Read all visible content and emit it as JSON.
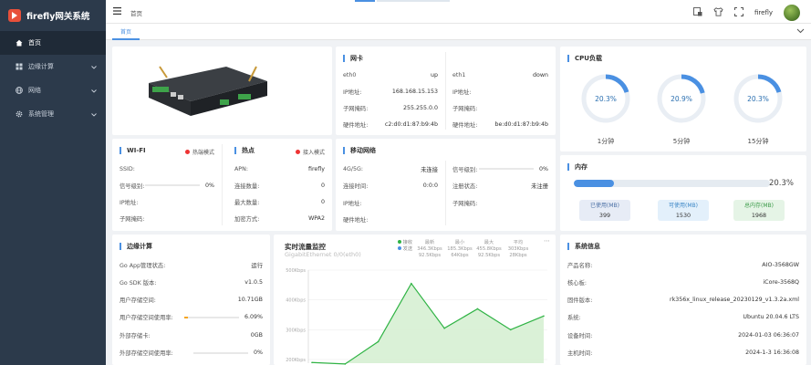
{
  "app": {
    "title": "firefly网关系统"
  },
  "sidebar": {
    "items": [
      {
        "label": "首页",
        "icon": "home-icon",
        "active": true,
        "has_arrow": false
      },
      {
        "label": "边缘计算",
        "icon": "grid-icon",
        "active": false,
        "has_arrow": true
      },
      {
        "label": "网络",
        "icon": "globe-icon",
        "active": false,
        "has_arrow": true
      },
      {
        "label": "系统管理",
        "icon": "gear-icon",
        "active": false,
        "has_arrow": true
      }
    ]
  },
  "header": {
    "breadcrumb": "首页",
    "username": "firefly"
  },
  "tabs": [
    {
      "label": "首页"
    }
  ],
  "nic": {
    "title": "网卡",
    "eth0": {
      "name": "eth0",
      "status": "up",
      "ip_label": "IP地址:",
      "ip": "168.168.15.153",
      "mask_label": "子网掩码:",
      "mask": "255.255.0.0",
      "mac_label": "硬件地址:",
      "mac": "c2:d0:d1:87:b9:4b"
    },
    "eth1": {
      "name": "eth1",
      "status": "down",
      "ip_label": "IP地址:",
      "ip": "",
      "mask_label": "子网掩码:",
      "mask": "",
      "mac_label": "硬件地址:",
      "mac": "be:d0:d1:87:b9:4b"
    }
  },
  "cpu": {
    "title": "CPU负载",
    "gauges": [
      {
        "value": "20.3%",
        "fraction": 0.203,
        "label": "1分钟"
      },
      {
        "value": "20.9%",
        "fraction": 0.209,
        "label": "5分钟"
      },
      {
        "value": "20.3%",
        "fraction": 0.203,
        "label": "15分钟"
      }
    ],
    "color": "#4a90e2"
  },
  "wifi": {
    "title": "WI-FI",
    "mode": "热端模式",
    "ssid_label": "SSID:",
    "ssid": "",
    "signal_label": "信号级别:",
    "signal": "0%",
    "ip_label": "IP地址:",
    "ip": "",
    "mask_label": "子网掩码:",
    "mask": ""
  },
  "hotspot": {
    "title": "热点",
    "mode": "接入模式",
    "apn_label": "APN:",
    "apn": "firefly",
    "conn_label": "连接数量:",
    "conn": "0",
    "max_label": "最大数量:",
    "max": "0",
    "enc_label": "加密方式:",
    "enc": "WPA2"
  },
  "mobile": {
    "title": "移动网络",
    "rows_left": [
      {
        "label": "4G/5G:",
        "value": "未连接"
      },
      {
        "label": "连接时间:",
        "value": "0:0:0"
      },
      {
        "label": "IP地址:",
        "value": ""
      },
      {
        "label": "硬件地址:",
        "value": ""
      }
    ],
    "rows_right": [
      {
        "label": "信号级别:",
        "value": "0%",
        "bar": 0
      },
      {
        "label": "注册状态:",
        "value": "未注册"
      },
      {
        "label": "子网掩码:",
        "value": ""
      }
    ]
  },
  "memory": {
    "title": "内存",
    "percent": "20.3%",
    "fraction": 0.203,
    "used_label": "已使用(MB)",
    "used": "399",
    "avail_label": "可使用(MB)",
    "avail": "1530",
    "total_label": "总内存(MB)",
    "total": "1968"
  },
  "edge": {
    "title": "边缘计算",
    "rows": [
      {
        "label": "Go App管理状态:",
        "value": "运行"
      },
      {
        "label": "Go SDK 版本:",
        "value": "v1.0.5"
      },
      {
        "label": "用户存储空间:",
        "value": "10.71GB"
      },
      {
        "label": "用户存储空间使用率:",
        "value": "6.09%",
        "bar": 0.0609
      },
      {
        "label": "外部存储卡:",
        "value": "0GB"
      },
      {
        "label": "外部存储空间使用率:",
        "value": "0%",
        "bar": 0
      }
    ]
  },
  "traffic": {
    "title": "实时流量监控",
    "subtitle": "GigabitEthernet 0/0(eth0)",
    "legend": [
      {
        "name": "接收",
        "color": "#2fb344"
      },
      {
        "name": "发送",
        "color": "#4a90e2"
      }
    ],
    "columns": [
      {
        "head": "最新",
        "recv": "346.3Kbps",
        "send": "92.5Kbps"
      },
      {
        "head": "最小",
        "recv": "185.3Kbps",
        "send": "64Kbps"
      },
      {
        "head": "最大",
        "recv": "455.8Kbps",
        "send": "92.5Kbps"
      },
      {
        "head": "平均",
        "recv": "303Kbps",
        "send": "28Kbps"
      }
    ]
  },
  "chart_data": {
    "type": "area",
    "title": "实时流量监控",
    "yticks": [
      "500Kbps",
      "400Kbps",
      "300Kbps",
      "200Kbps"
    ],
    "ylim": [
      200,
      500
    ],
    "series": [
      {
        "name": "接收",
        "values": [
          190,
          185,
          260,
          455,
          305,
          370,
          300,
          346
        ]
      }
    ]
  },
  "sysinfo": {
    "title": "系统信息",
    "rows": [
      {
        "label": "产品名称:",
        "value": "AIO-3568GW"
      },
      {
        "label": "核心板:",
        "value": "iCore-3568Q"
      },
      {
        "label": "固件版本:",
        "value": "rk356x_linux_release_20230129_v1.3.2a.xml"
      },
      {
        "label": "系统:",
        "value": "Ubuntu 20.04.6 LTS"
      },
      {
        "label": "设备时间:",
        "value": "2024-01-03 06:36:07"
      },
      {
        "label": "主机时间:",
        "value": "2024-1-3 16:36:08"
      }
    ]
  }
}
